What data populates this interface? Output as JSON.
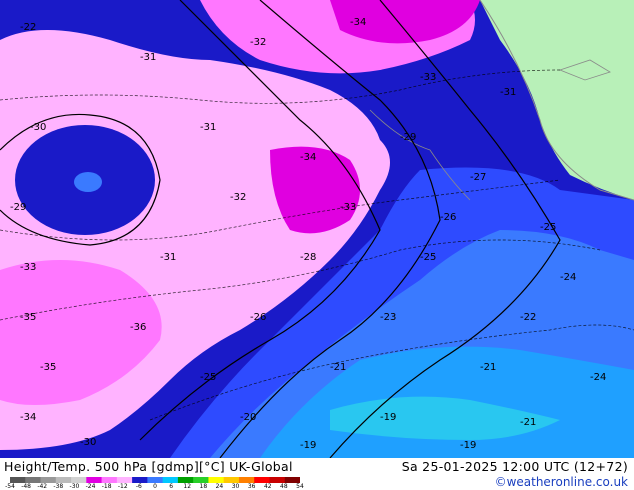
{
  "map": {
    "colors": {
      "ocean": "#1a1ac8",
      "land": "#b8f0b8",
      "magenta": "#e000e0",
      "light_magenta": "#ff77ff",
      "pink": "#ffb3ff",
      "blue_mid": "#2e4bff",
      "blue_light": "#3a7aff",
      "cyan_blue": "#1fa0ff",
      "cyan": "#29c7f0",
      "contour": "#000000",
      "coast": "#8a8a8a"
    },
    "contour_labels": [
      "-36",
      "-35",
      "-34",
      "-33",
      "-32",
      "-31",
      "-30",
      "-29",
      "-28",
      "-27",
      "-26",
      "-25",
      "-24",
      "-23",
      "-22",
      "-21",
      "-20",
      "-19"
    ]
  },
  "footer": {
    "title": "Height/Temp. 500 hPa [gdmp][°C] UK-Global",
    "valid_time": "Sa 25-01-2025 12:00 UTC (12+72)",
    "credit": "©weatheronline.co.uk",
    "scale_ticks": [
      "-54",
      "-48",
      "-42",
      "-38",
      "-30",
      "-24",
      "-18",
      "-12",
      "-6",
      "0",
      "6",
      "12",
      "18",
      "24",
      "30",
      "36",
      "42",
      "48",
      "54"
    ],
    "scale_colors": [
      "#555555",
      "#777777",
      "#999999",
      "#bbbbbb",
      "#d2d2d2",
      "#e200e2",
      "#ff77ff",
      "#ffb3ff",
      "#1a1ac8",
      "#3a7aff",
      "#00c8ff",
      "#00a000",
      "#28d028",
      "#ffff00",
      "#ffc800",
      "#ff8000",
      "#ff0000",
      "#c80000",
      "#800000"
    ]
  }
}
